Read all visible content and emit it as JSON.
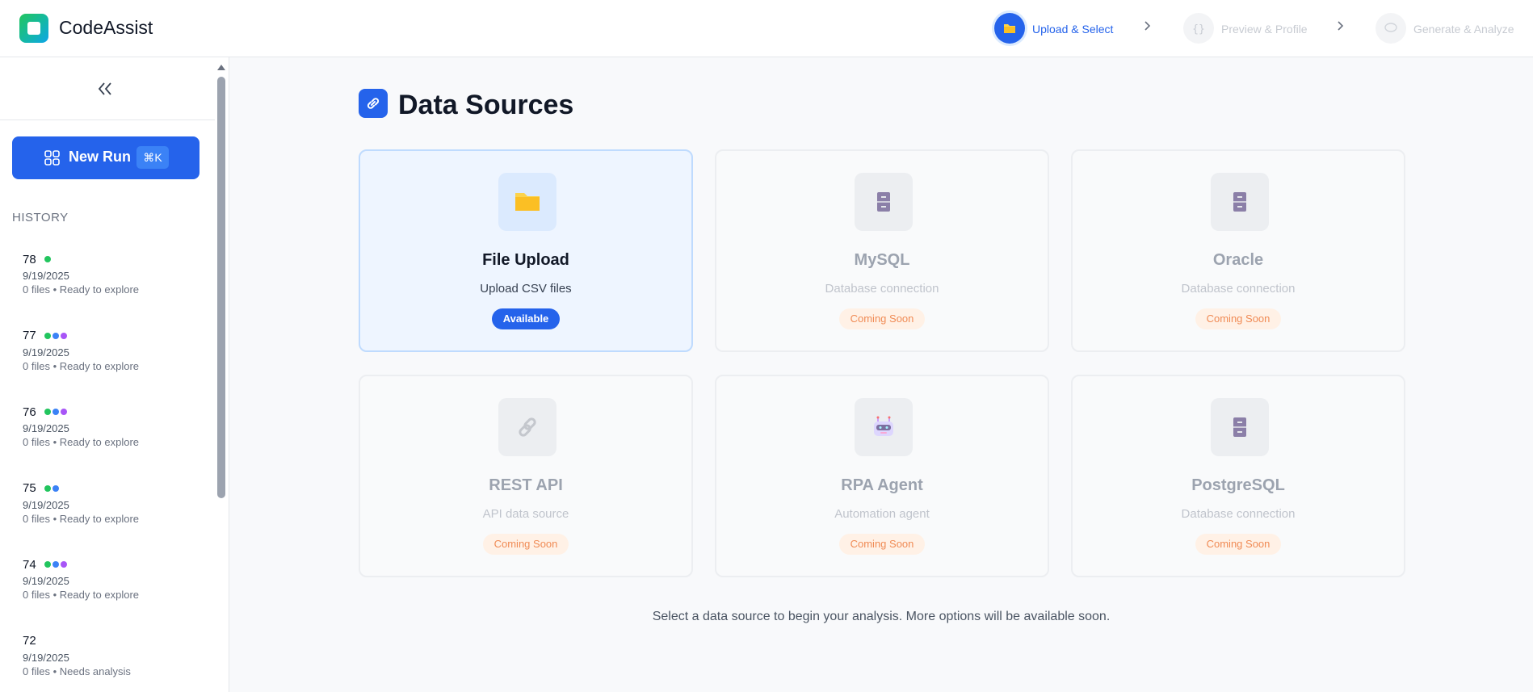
{
  "app": {
    "title": "CodeAssist"
  },
  "steps": [
    {
      "label": "Upload & Select",
      "state": "active",
      "icon": "folder-icon"
    },
    {
      "label": "Preview & Profile",
      "state": "inactive",
      "icon": "braces-icon"
    },
    {
      "label": "Generate & Analyze",
      "state": "inactive",
      "icon": "chat-bubble-icon"
    }
  ],
  "sidebar": {
    "new_run_label": "New Run",
    "new_run_shortcut": "⌘K",
    "history_title": "HISTORY",
    "history": [
      {
        "num": "78",
        "dots": [
          "#22c55e"
        ],
        "date": "9/19/2025",
        "status": "0 files • Ready to explore"
      },
      {
        "num": "77",
        "dots": [
          "#22c55e",
          "#3b82f6",
          "#a855f7"
        ],
        "date": "9/19/2025",
        "status": "0 files • Ready to explore"
      },
      {
        "num": "76",
        "dots": [
          "#22c55e",
          "#3b82f6",
          "#a855f7"
        ],
        "date": "9/19/2025",
        "status": "0 files • Ready to explore"
      },
      {
        "num": "75",
        "dots": [
          "#22c55e",
          "#3b82f6"
        ],
        "date": "9/19/2025",
        "status": "0 files • Ready to explore"
      },
      {
        "num": "74",
        "dots": [
          "#22c55e",
          "#3b82f6",
          "#a855f7"
        ],
        "date": "9/19/2025",
        "status": "0 files • Ready to explore"
      },
      {
        "num": "72",
        "dots": [],
        "date": "9/19/2025",
        "status": "0 files • Needs analysis"
      }
    ]
  },
  "main": {
    "title": "Data Sources",
    "sources": [
      {
        "name": "File Upload",
        "desc": "Upload CSV files",
        "badge": "Available",
        "icon": "folder-icon"
      },
      {
        "name": "MySQL",
        "desc": "Database connection",
        "badge": "Coming Soon",
        "icon": "file-cabinet-icon"
      },
      {
        "name": "Oracle",
        "desc": "Database connection",
        "badge": "Coming Soon",
        "icon": "file-cabinet-icon"
      },
      {
        "name": "REST API",
        "desc": "API data source",
        "badge": "Coming Soon",
        "icon": "link-icon"
      },
      {
        "name": "RPA Agent",
        "desc": "Automation agent",
        "badge": "Coming Soon",
        "icon": "robot-icon"
      },
      {
        "name": "PostgreSQL",
        "desc": "Database connection",
        "badge": "Coming Soon",
        "icon": "file-cabinet-icon"
      }
    ],
    "footer": "Select a data source to begin your analysis. More options will be available soon."
  },
  "colors": {
    "accent": "#2563eb",
    "coming_soon_bg": "#fff1e6",
    "coming_soon_text": "#f08b55",
    "dot_green": "#22c55e",
    "dot_blue": "#3b82f6",
    "dot_purple": "#a855f7"
  }
}
